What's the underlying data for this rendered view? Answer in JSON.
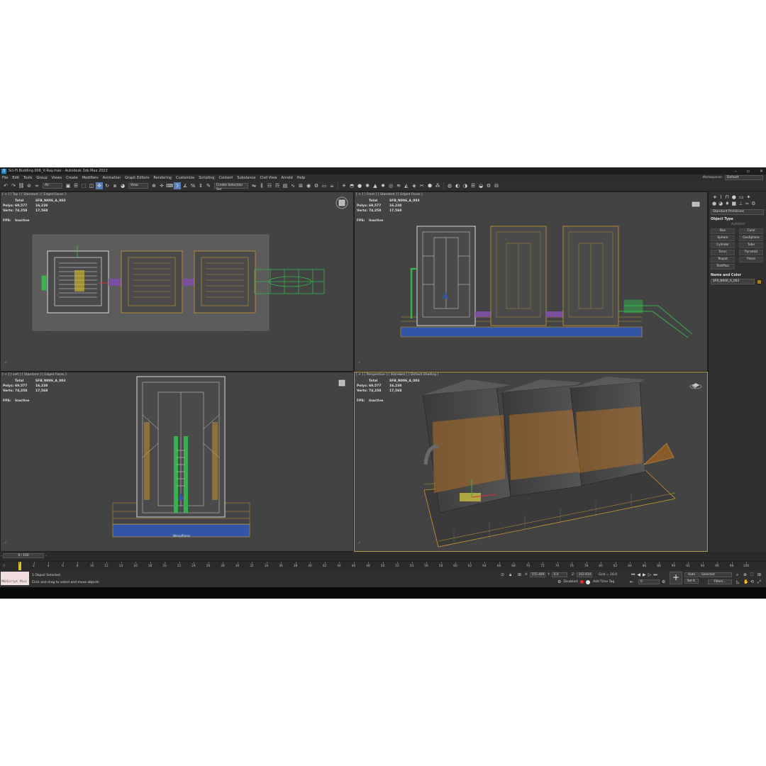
{
  "window": {
    "title": "Sci-Fi Building 006_V-Ray.max - Autodesk 3ds Max 2022",
    "icon": "3"
  },
  "menu": [
    "File",
    "Edit",
    "Tools",
    "Group",
    "Views",
    "Create",
    "Modifiers",
    "Animation",
    "Graph Editors",
    "Rendering",
    "Customize",
    "Scripting",
    "Content",
    "Substance",
    "Civil View",
    "Arnold",
    "Help"
  ],
  "workspace": {
    "label": "Workspaces:",
    "value": "Default"
  },
  "toolbar": {
    "filter_select": "All",
    "view_select": "View",
    "named_selection": "Create Selection Set"
  },
  "stats": {
    "col_header_total": "Total",
    "object_name": "SFB_N006_A_003",
    "polys_label": "Polys:",
    "polys_total": "69,577",
    "polys_sel": "16,238",
    "verts_label": "Verts:",
    "verts_total": "74,258",
    "verts_sel": "17,568",
    "fps_label": "FPS:",
    "fps_value": "Inactive"
  },
  "viewports": {
    "top": {
      "label": "[ + ] [ Top ] [ Standard ] [ Edged Faces ]"
    },
    "front": {
      "label": "[ + ] [ Front ] [ Standard ] [ Edged Faces ]"
    },
    "left": {
      "label": "[ + ] [ Left ] [ Standard ] [ Edged Faces ]",
      "grid_name": "WorpPlane"
    },
    "perspective": {
      "label": "[ + ] [ Perspective ] [ Standard ] [ Default Shading ]"
    }
  },
  "command_panel": {
    "primitive_type": "Standard Primitives",
    "object_type_title": "Object Type",
    "autogrid": "AutoGrid",
    "primitives": [
      "Box",
      "Cone",
      "Sphere",
      "GeoSphere",
      "Cylinder",
      "Tube",
      "Torus",
      "Pyramid",
      "Teapot",
      "Plane",
      "TextPlus"
    ],
    "name_color_title": "Name and Color",
    "object_name": "SFB_N006_A_003",
    "object_color": "#a8861a"
  },
  "timeline": {
    "slider": "0 / 100",
    "frames": [
      "0",
      "2",
      "4",
      "6",
      "8",
      "10",
      "12",
      "14",
      "16",
      "18",
      "20",
      "22",
      "24",
      "26",
      "28",
      "30",
      "32",
      "34",
      "36",
      "38",
      "40",
      "42",
      "44",
      "46",
      "48",
      "50",
      "52",
      "54",
      "56",
      "58",
      "60",
      "62",
      "64",
      "66",
      "68",
      "70",
      "72",
      "74",
      "76",
      "78",
      "80",
      "82",
      "84",
      "86",
      "88",
      "90",
      "92",
      "94",
      "96",
      "98",
      "100"
    ]
  },
  "status": {
    "maxscript": "MAXScript Mini",
    "selection": "1 Object Selected",
    "prompt": "Click and drag to select and move objects",
    "x_label": "X:",
    "x_value": "555.489",
    "y_label": "Y:",
    "y_value": "0.0",
    "z_label": "Z:",
    "z_value": "102.934",
    "grid": "Grid = 10.0",
    "disabled": "Disabled:",
    "add_time_tag": "Add Time Tag",
    "frame": "0",
    "auto_key": "Auto",
    "set_key": "Set K.",
    "key_filter": "Selected",
    "filters": "Filters..."
  },
  "colors": {
    "viewport_bg": "#434343",
    "wire_white": "#ffffff",
    "wire_orange": "#c99a2e",
    "wire_green": "#37b24d",
    "accent_purple": "#7b4fa0",
    "accent_blue": "#3455a5",
    "active_border": "#b59a4a"
  }
}
